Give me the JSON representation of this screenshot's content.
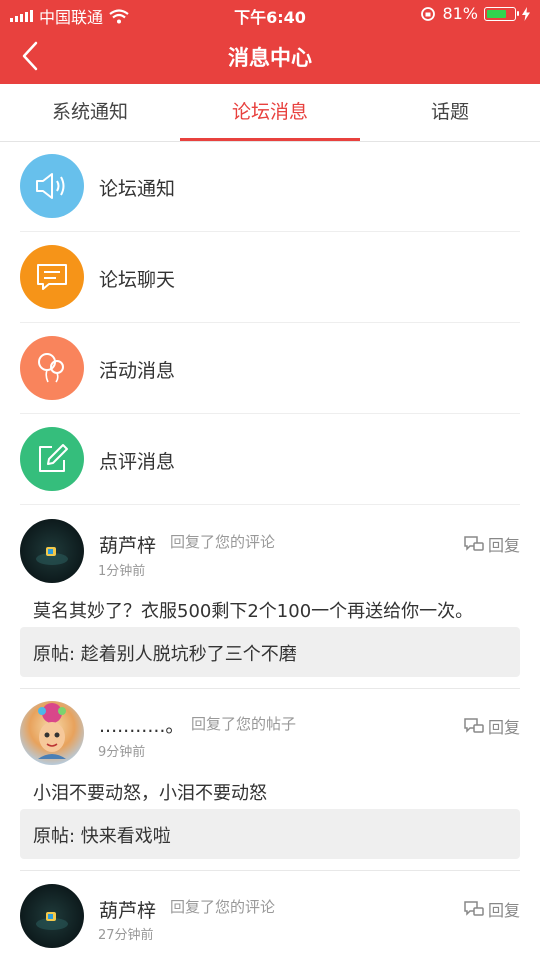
{
  "status_bar": {
    "carrier": "中国联通",
    "time": "下午6:40",
    "battery": "81%",
    "battery_level": 0.81
  },
  "nav": {
    "title": "消息中心"
  },
  "tabs": [
    {
      "label": "系统通知",
      "active": false
    },
    {
      "label": "论坛消息",
      "active": true
    },
    {
      "label": "话题",
      "active": false
    }
  ],
  "categories": [
    {
      "label": "论坛通知",
      "icon": "speaker-icon",
      "color": "#67c0ec"
    },
    {
      "label": "论坛聊天",
      "icon": "chat-bubble-icon",
      "color": "#f69418"
    },
    {
      "label": "活动消息",
      "icon": "balloons-icon",
      "color": "#f9845c"
    },
    {
      "label": "点评消息",
      "icon": "edit-icon",
      "color": "#35be7c"
    }
  ],
  "messages": [
    {
      "name": "葫芦梓",
      "action": "回复了您的评论",
      "time": "1分钟前",
      "reply": "回复",
      "content": "莫名其妙了？衣服500剩下2个100一个再送给你一次。",
      "original": "原帖: 趁着别人脱坑秒了三个不磨"
    },
    {
      "name": "...........。",
      "action": "回复了您的帖子",
      "time": "9分钟前",
      "reply": "回复",
      "content": "小泪不要动怒，小泪不要动怒",
      "original": "原帖: 快来看戏啦"
    },
    {
      "name": "葫芦梓",
      "action": "回复了您的评论",
      "time": "27分钟前",
      "reply": "回复"
    }
  ]
}
